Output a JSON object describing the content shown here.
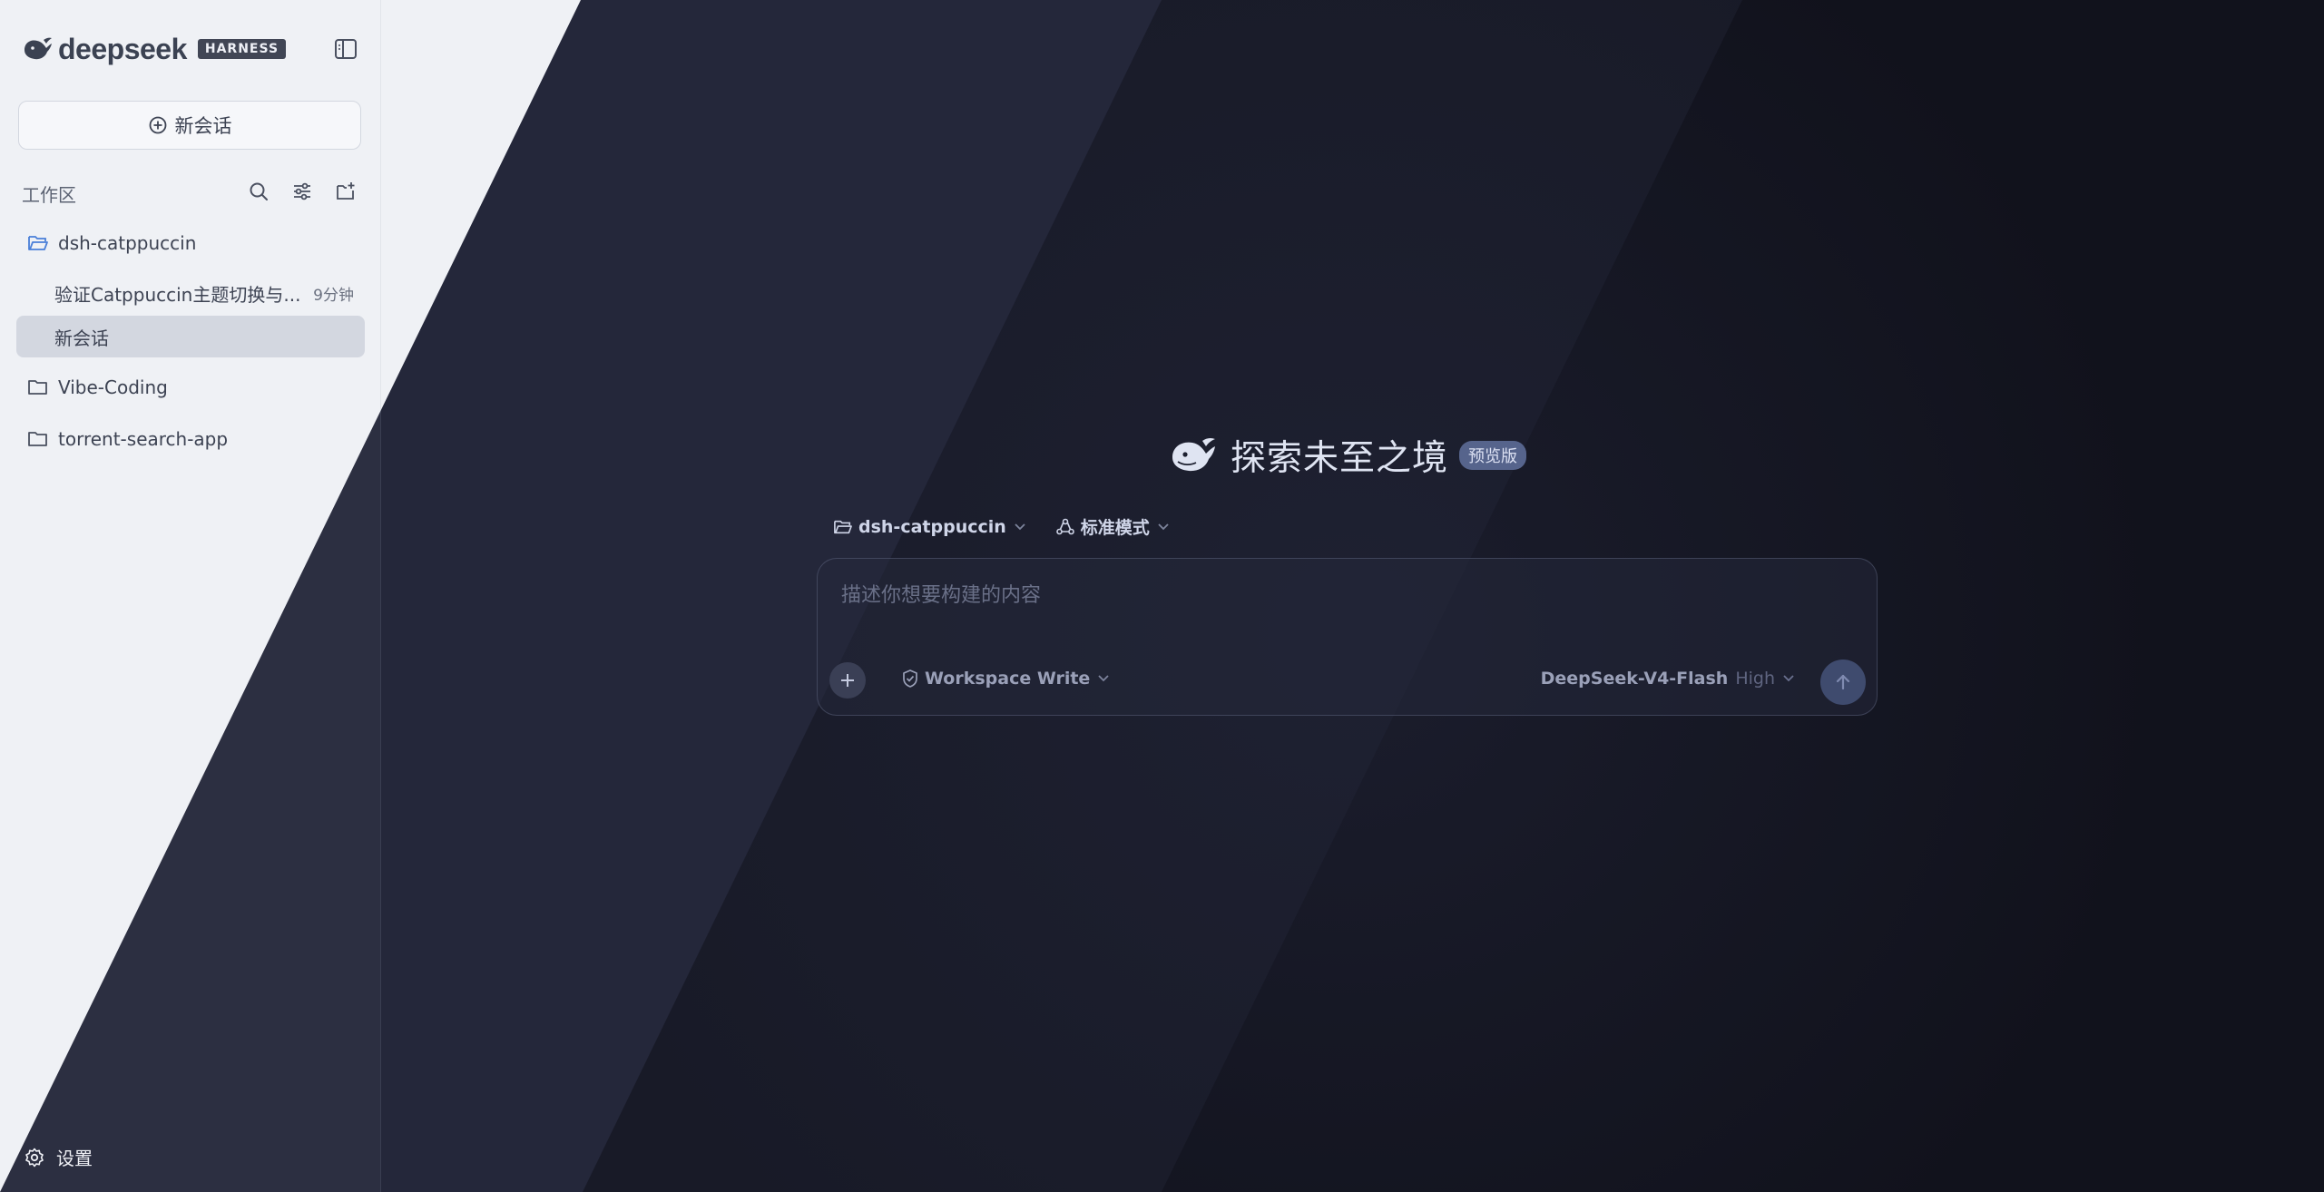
{
  "brand": {
    "wordmark": "deepseek",
    "badge": "HARNESS",
    "logo_icon": "whale-logo-icon"
  },
  "sidebar": {
    "toggle_icon": "sidebar-toggle-icon",
    "new_chat_label": "新会话",
    "workspace_label": "工作区",
    "workspace_actions": [
      "search-icon",
      "filter-icon",
      "new-folder-icon"
    ],
    "projects": [
      {
        "name": "dsh-catppuccin",
        "open": true
      },
      {
        "name": "Vibe-Coding",
        "open": false
      },
      {
        "name": "torrent-search-app",
        "open": false
      }
    ],
    "sessions": [
      {
        "title": "验证Catppuccin主题切换与...",
        "time": "9分钟",
        "active": false
      },
      {
        "title": "新会话",
        "time": "",
        "active": true
      }
    ],
    "settings_label": "设置"
  },
  "main": {
    "hero_title": "探索未至之境",
    "hero_badge": "预览版",
    "project_selector": "dsh-catppuccin",
    "mode_selector": "标准模式",
    "composer": {
      "placeholder": "描述你想要构建的内容",
      "value": "",
      "permission": "Workspace Write",
      "model": "DeepSeek-V4-Flash",
      "effort": "High"
    }
  },
  "colors": {
    "sidebar_bg": "#eef0f5",
    "dark_bg": "#1a1d2b",
    "accent": "#4a7fd8",
    "badge_bg": "#56648c"
  }
}
